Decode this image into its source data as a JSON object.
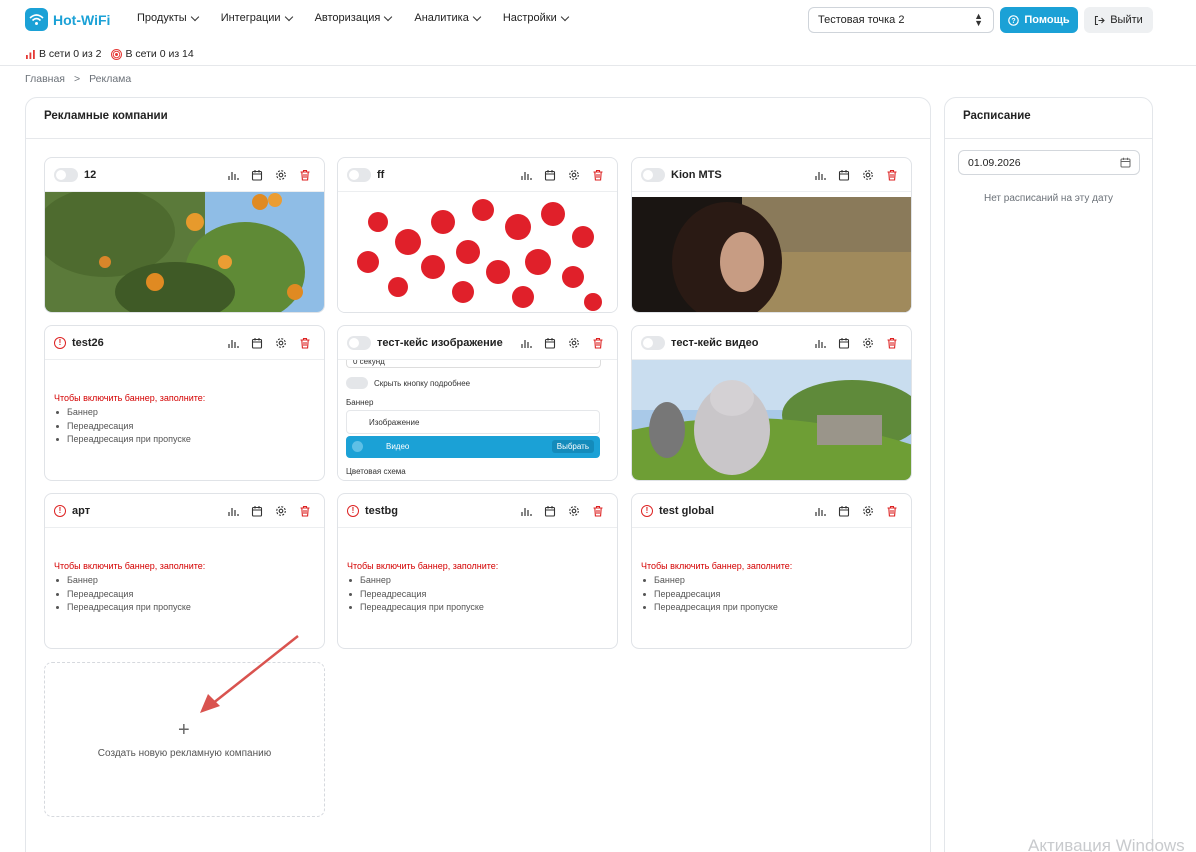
{
  "app": {
    "brand": "Hot-WiFi"
  },
  "nav": [
    "Продукты",
    "Интеграции",
    "Авторизация",
    "Аналитика",
    "Настройки"
  ],
  "header": {
    "point": "Тестовая точка 2",
    "help": "Помощь",
    "logout": "Выйти"
  },
  "status": {
    "online1": "В сети 0 из 2",
    "online2": "В сети 0 из 14"
  },
  "breadcrumb": {
    "home": "Главная",
    "sep": ">",
    "current": "Реклама"
  },
  "campaigns": {
    "title": "Рекламные компании",
    "items": [
      {
        "name": "12",
        "state": "toggle",
        "media": "orange-tree"
      },
      {
        "name": "ff",
        "state": "toggle",
        "media": "red-emoji"
      },
      {
        "name": "Kion MTS",
        "state": "toggle",
        "media": "woman-car"
      },
      {
        "name": "test26",
        "state": "warning"
      },
      {
        "name": "тест-кейс изображение",
        "state": "toggle",
        "media": "form-screenshot"
      },
      {
        "name": "тест-кейс видео",
        "state": "toggle",
        "media": "bunny"
      },
      {
        "name": "арт",
        "state": "warning"
      },
      {
        "name": "testbg",
        "state": "warning"
      },
      {
        "name": "test global",
        "state": "warning"
      }
    ],
    "warning_title": "Чтобы включить баннер, заполните:",
    "requirements": [
      "Баннер",
      "Переадресация",
      "Переадресация при пропуске"
    ],
    "create_label": "Создать новую рекламную компанию"
  },
  "form_preview": {
    "seconds": "0 секунд",
    "hide_more": "Скрыть кнопку подробнее",
    "banner": "Баннер",
    "image": "Изображение",
    "video": "Видео",
    "choose": "Выбрать",
    "color_scheme": "Цветовая схема"
  },
  "schedule": {
    "title": "Расписание",
    "date": "01.09.2026",
    "empty": "Нет расписаний на эту дату"
  },
  "watermark": "Активация Windows",
  "colors": {
    "accent": "#1ba1d6",
    "danger": "#d40000"
  }
}
